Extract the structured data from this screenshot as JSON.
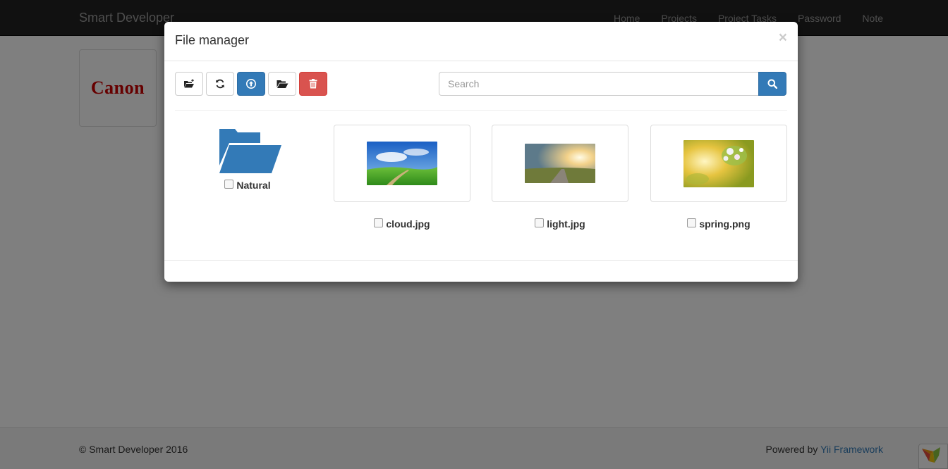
{
  "navbar": {
    "brand": "Smart Developer",
    "links": [
      "Home",
      "Projects",
      "Project Tasks",
      "Password",
      "Note"
    ]
  },
  "page_logo": {
    "text": "Canon"
  },
  "footer": {
    "copyright": "© Smart Developer 2016",
    "powered_prefix": "Powered by ",
    "powered_link": "Yii Framework"
  },
  "modal": {
    "title": "File manager",
    "close": "×",
    "toolbar": {
      "buttons": [
        {
          "icon": "folder-add-icon",
          "style": "default"
        },
        {
          "icon": "refresh-icon",
          "style": "default"
        },
        {
          "icon": "upload-icon",
          "style": "primary"
        },
        {
          "icon": "folder-open-icon",
          "style": "default"
        },
        {
          "icon": "trash-icon",
          "style": "danger"
        }
      ]
    },
    "search": {
      "placeholder": "Search",
      "value": ""
    },
    "folders": [
      {
        "name": "Natural",
        "checked": false
      }
    ],
    "files": [
      {
        "name": "cloud.jpg",
        "checked": false
      },
      {
        "name": "light.jpg",
        "checked": false
      },
      {
        "name": "spring.png",
        "checked": false
      }
    ]
  },
  "colors": {
    "primary": "#337ab7",
    "danger": "#d9534f",
    "navbar": "#222222",
    "folder": "#337ab7"
  }
}
